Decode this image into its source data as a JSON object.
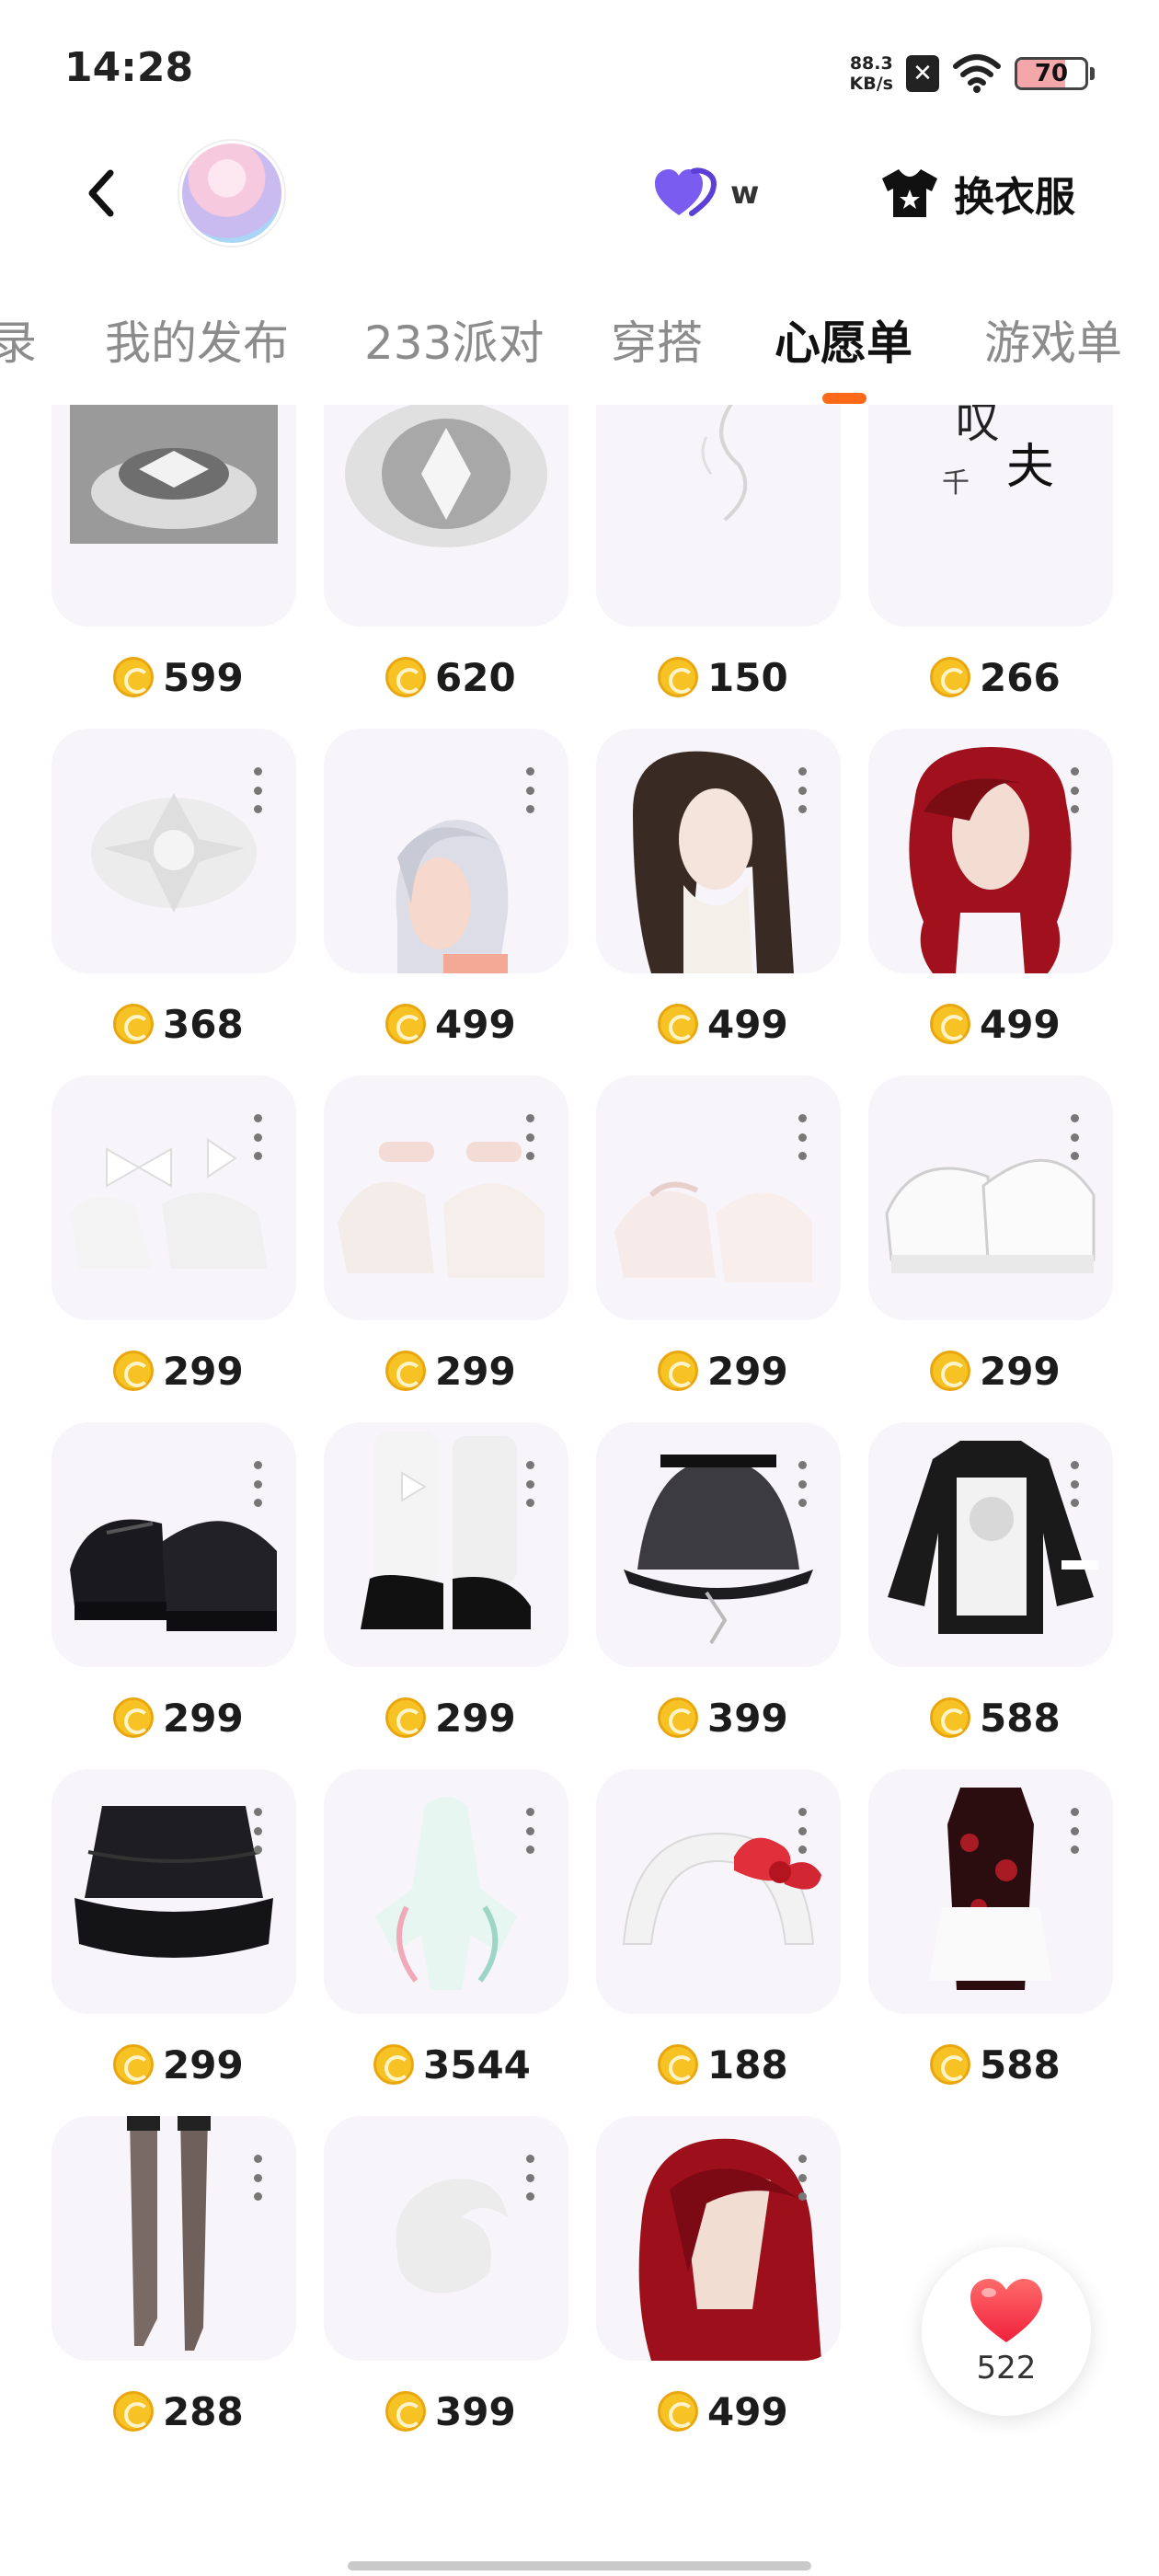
{
  "status_bar": {
    "time": "14:28",
    "net_speed_value": "88.3",
    "net_speed_unit": "KB/s",
    "battery": "70",
    "battery_level": 0.7
  },
  "header": {
    "avatar_icon": "avatar-image",
    "heart_label": "w",
    "change_clothes_label": "换衣服"
  },
  "tabs": [
    {
      "label": "录"
    },
    {
      "label": "我的发布"
    },
    {
      "label": "233派对"
    },
    {
      "label": "穿搭"
    },
    {
      "label": "心愿单"
    },
    {
      "label": "游戏单"
    }
  ],
  "active_tab": "心愿单",
  "items": [
    {
      "price": "599",
      "icon": "crystal-stand-item"
    },
    {
      "price": "620",
      "icon": "crystal-item"
    },
    {
      "price": "150",
      "icon": "wisp-item"
    },
    {
      "price": "266",
      "icon": "calligraphy-item"
    },
    {
      "price": "368",
      "icon": "white-ornament-item"
    },
    {
      "price": "499",
      "icon": "silver-short-hair"
    },
    {
      "price": "499",
      "icon": "black-long-hair"
    },
    {
      "price": "499",
      "icon": "red-wavy-hair"
    },
    {
      "price": "299",
      "icon": "white-bow-heels"
    },
    {
      "price": "299",
      "icon": "white-platform-shoes"
    },
    {
      "price": "299",
      "icon": "pink-platform-shoes"
    },
    {
      "price": "299",
      "icon": "white-chunky-shoes"
    },
    {
      "price": "299",
      "icon": "black-mary-janes"
    },
    {
      "price": "299",
      "icon": "white-leg-warmer-boots"
    },
    {
      "price": "399",
      "icon": "black-lace-skirt"
    },
    {
      "price": "588",
      "icon": "graphic-sweater"
    },
    {
      "price": "299",
      "icon": "black-ruffle-skirt"
    },
    {
      "price": "3544",
      "icon": "mint-dress"
    },
    {
      "price": "188",
      "icon": "kitty-bow-headband"
    },
    {
      "price": "588",
      "icon": "maid-qipao"
    },
    {
      "price": "288",
      "icon": "fishnet-stockings"
    },
    {
      "price": "399",
      "icon": "white-fluffy-tail"
    },
    {
      "price": "499",
      "icon": "red-hair-bangs"
    }
  ],
  "like_fab": {
    "count": "522"
  },
  "colors": {
    "accent": "#ff6a1a",
    "coin": "#f7c324",
    "heart_purple": "#7b5cf0",
    "heart_red": "#ff3b45",
    "card_bg": "#f7f5fa"
  }
}
